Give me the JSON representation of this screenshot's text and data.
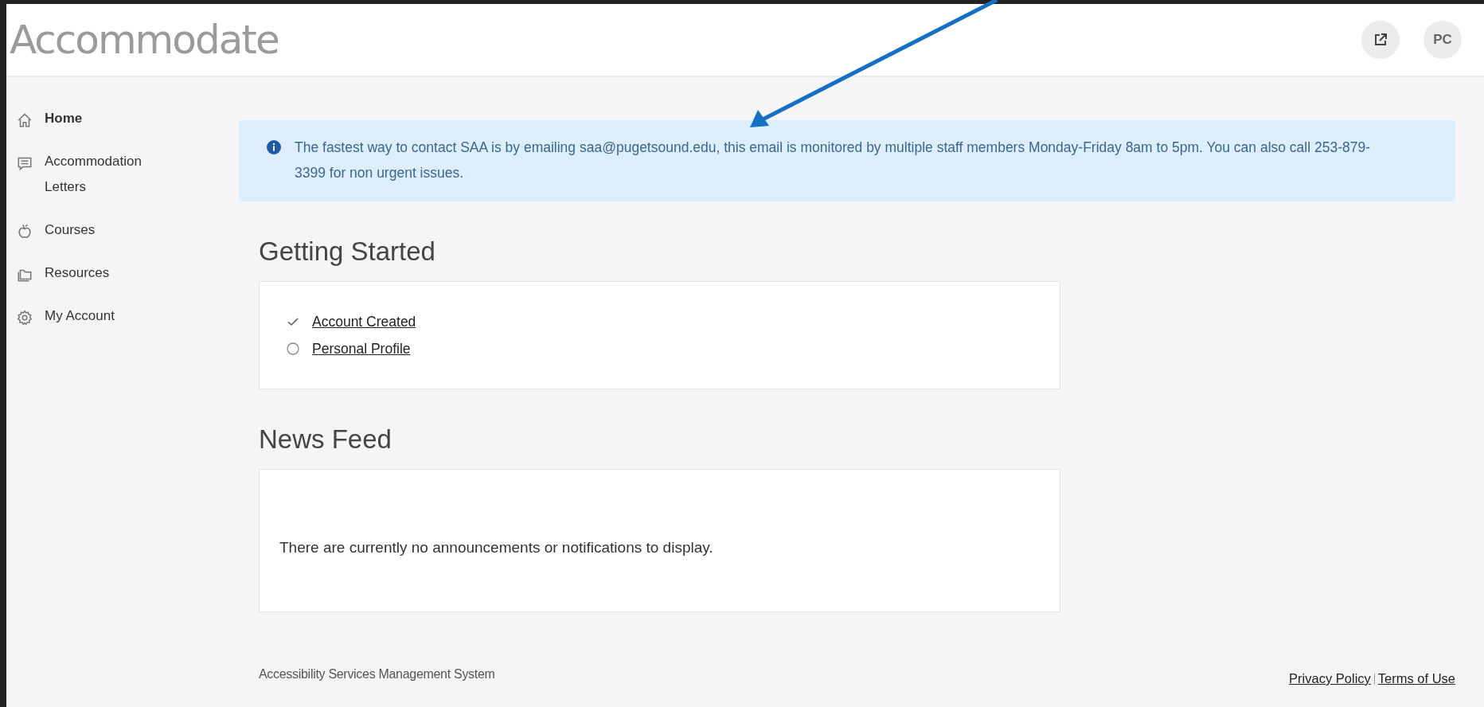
{
  "header": {
    "logo": "Accommodate",
    "avatar": "PC"
  },
  "sidebar": {
    "items": [
      {
        "label": "Home",
        "selected": true
      },
      {
        "label": "Accommodation Letters",
        "selected": false
      },
      {
        "label": "Courses",
        "selected": false
      },
      {
        "label": "Resources",
        "selected": false
      },
      {
        "label": "My Account",
        "selected": false
      }
    ]
  },
  "banner": {
    "text": "The fastest way to contact SAA is by emailing saa@pugetsound.edu, this email is monitored by multiple staff members Monday-Friday 8am to 5pm. You can also call 253-879-3399 for non urgent issues."
  },
  "getting_started": {
    "title": "Getting Started",
    "steps": [
      {
        "label": "Account Created",
        "checked": true
      },
      {
        "label": "Personal Profile",
        "checked": false
      }
    ]
  },
  "news_feed": {
    "title": "News Feed",
    "message": "There are currently no announcements or notifications to display."
  },
  "footer": {
    "system": "Accessibility Services Management System",
    "links": [
      "Privacy Policy",
      "Terms of Use"
    ]
  }
}
